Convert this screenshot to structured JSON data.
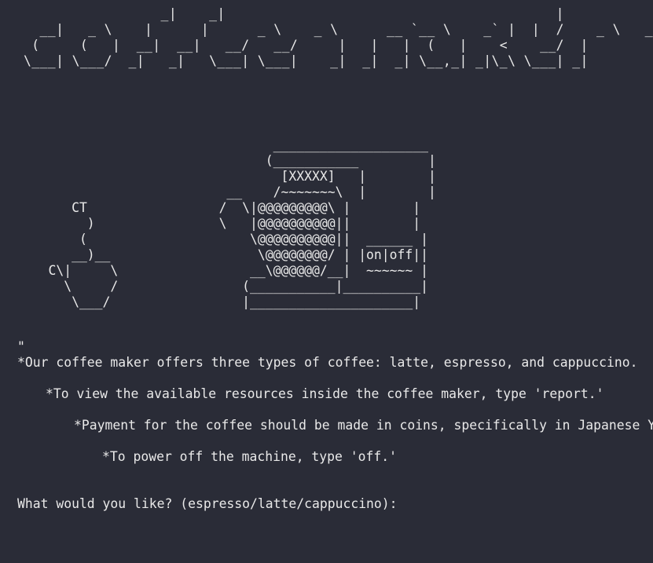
{
  "terminal": {
    "banner_art": "                 _|    _|                                         |\n  __|   _ \\    |      |      _ \\    _ \\      __ `__ \\    _` |  |  /    _ \\   __|\n (     (   |  __|  __|   __/   __/     |   |   |  (   |    <    __/  |\n\\___| \\___/  _|   _|   \\___| \\___|    _|  _|  _| \\__,_| _|\\_\\ \\___| _|",
    "machine_art": "                                 ____________________\n                                (___________         |\n                                  [XXXXX]   |        |\n                           __    /~~~~~~~\\  |        |\n       CT                 /  \\|@@@@@@@@@\\ |        |\n         )                \\   |@@@@@@@@@@||        |\n        (                     \\@@@@@@@@@@||  ______ |\n       __)__                   \\@@@@@@@@/ | |on|off||\n    C\\|     \\                 __\\@@@@@@/__|  ~~~~~~ |\n      \\     /                (___________|__________|\n       \\___/                 |_____________________|",
    "quote_mark": "\"",
    "info_lines": [
      "*Our coffee maker offers three types of coffee: latte, espresso, and cappuccino.",
      "*To view the available resources inside the coffee maker, type 'report.'",
      "*Payment for the coffee should be made in coins, specifically in Japanese Yen.",
      "*To power off the machine, type 'off.'"
    ],
    "prompt": "What would you like? (espresso/latte/cappuccino):",
    "input_value": ""
  }
}
